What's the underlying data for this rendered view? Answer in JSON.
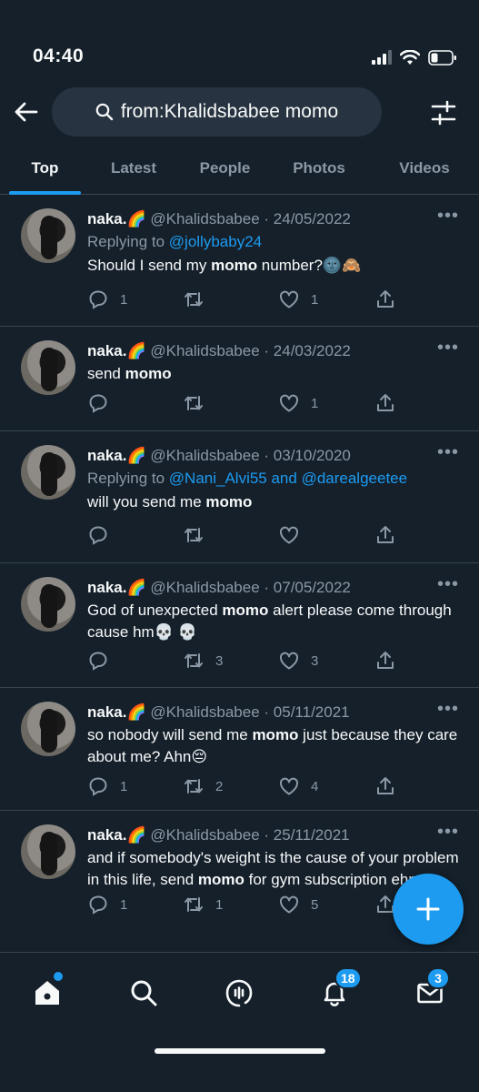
{
  "status_bar": {
    "time": "04:40"
  },
  "search": {
    "query": "from:Khalidsbabee momo"
  },
  "tabs": [
    {
      "label": "Top",
      "active": true
    },
    {
      "label": "Latest",
      "active": false
    },
    {
      "label": "People",
      "active": false
    },
    {
      "label": "Photos",
      "active": false
    },
    {
      "label": "Videos",
      "active": false
    }
  ],
  "tweets": [
    {
      "name": "naka.🌈",
      "handle": "@Khalidsbabee",
      "date": "· 24/05/2022",
      "reply_prefix": "Replying to ",
      "reply_to": "@jollybaby24",
      "text_parts": [
        "Should I send my ",
        "momo",
        " number?🌚🙈"
      ],
      "replies": "1",
      "retweets": "",
      "likes": "1"
    },
    {
      "name": "naka.🌈",
      "handle": "@Khalidsbabee",
      "date": "· 24/03/2022",
      "reply_prefix": "",
      "reply_to": "",
      "text_parts": [
        "send ",
        "momo",
        ""
      ],
      "replies": "",
      "retweets": "",
      "likes": "1"
    },
    {
      "name": "naka.🌈",
      "handle": "@Khalidsbabee",
      "date": "· 03/10/2020",
      "reply_prefix": "Replying to ",
      "reply_to": "@Nani_Alvi55 and @darealgeetee",
      "text_parts": [
        "will you send me ",
        "momo",
        ""
      ],
      "replies": "",
      "retweets": "",
      "likes": ""
    },
    {
      "name": "naka.🌈",
      "handle": "@Khalidsbabee",
      "date": "· 07/05/2022",
      "reply_prefix": "",
      "reply_to": "",
      "text_parts": [
        "God of unexpected ",
        "momo",
        " alert please come through cause hm💀 💀"
      ],
      "replies": "",
      "retweets": "3",
      "likes": "3"
    },
    {
      "name": "naka.🌈",
      "handle": "@Khalidsbabee",
      "date": "· 05/11/2021",
      "reply_prefix": "",
      "reply_to": "",
      "text_parts": [
        "so nobody will send me ",
        "momo",
        " just because they care about me? Ahn😔"
      ],
      "replies": "1",
      "retweets": "2",
      "likes": "4"
    },
    {
      "name": "naka.🌈",
      "handle": "@Khalidsbabee",
      "date": "· 25/11/2021",
      "reply_prefix": "",
      "reply_to": "",
      "text_parts": [
        "and if somebody's weight is the cause of your problem in this life, send ",
        "momo",
        " for gym subscription ehn"
      ],
      "replies": "1",
      "retweets": "1",
      "likes": "5"
    }
  ],
  "bottom_nav": {
    "notifications_badge": "18",
    "messages_badge": "3"
  },
  "icons": {
    "back": "back-arrow-icon",
    "search": "search-icon",
    "filter": "filter-icon",
    "reply": "reply-icon",
    "retweet": "retweet-icon",
    "like": "heart-icon",
    "share": "share-icon",
    "home": "home-icon",
    "explore": "search-icon",
    "spaces": "spaces-icon",
    "notifications": "bell-icon",
    "messages": "mail-icon",
    "compose": "plus-icon"
  },
  "colors": {
    "background": "#15202b",
    "accent": "#1d9bf0",
    "muted": "#8b98a5",
    "divider": "#38444d"
  }
}
